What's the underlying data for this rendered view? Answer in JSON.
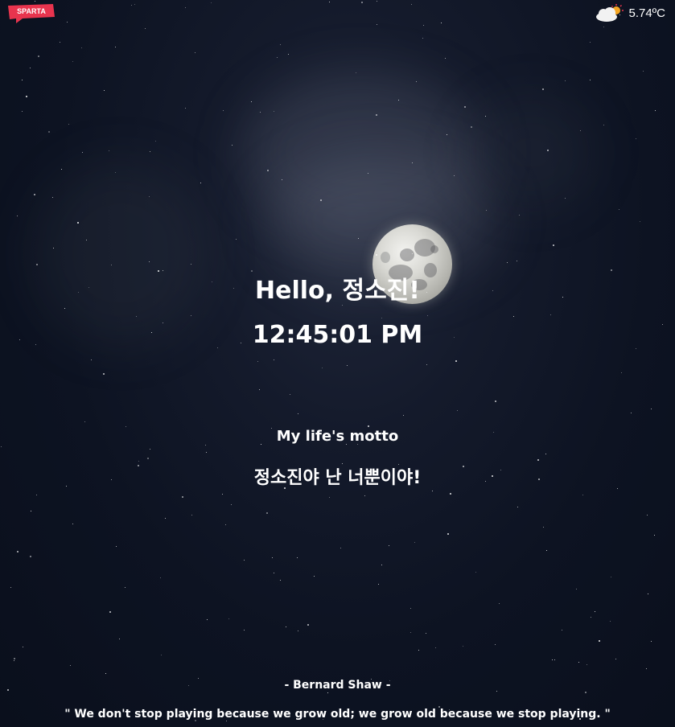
{
  "brand": {
    "logo_text": "SPARTA"
  },
  "weather": {
    "icon": "cloud-sun-icon",
    "temperature": "5.74ºC"
  },
  "greeting": "Hello, 정소진!",
  "clock": "12:45:01 PM",
  "motto": {
    "label": "My life's motto",
    "text": "정소진야 난 너뿐이야!"
  },
  "quote": {
    "author": "- Bernard Shaw -",
    "text": "\" We don't stop playing because we grow old; we grow old because we stop playing. \""
  },
  "colors": {
    "sky": "#0d1322",
    "text": "#ffffff",
    "logo": "#e8344e"
  }
}
